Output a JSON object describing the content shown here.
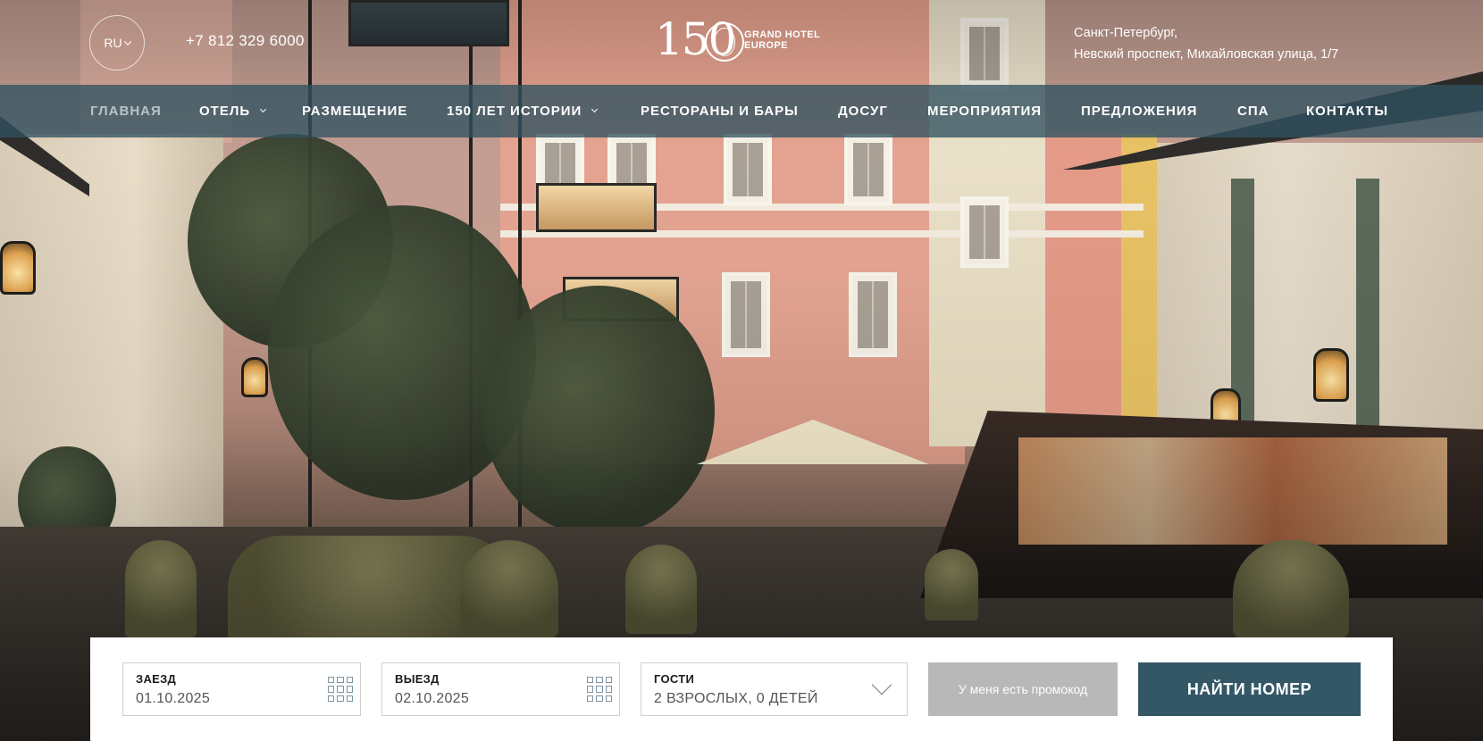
{
  "header": {
    "language": "RU",
    "phone": "+7 812 329 6000",
    "logo": {
      "number": "150",
      "line1": "GRAND HOTEL",
      "line2": "EUROPE"
    },
    "address": {
      "line1": "Санкт-Петербург,",
      "line2": "Невский проспект, Михайловская улица, 1/7"
    }
  },
  "nav": {
    "items": [
      {
        "label": "ГЛАВНАЯ",
        "active": true
      },
      {
        "label": "ОТЕЛЬ",
        "dropdown": true
      },
      {
        "label": "РАЗМЕЩЕНИЕ"
      },
      {
        "label": "150 ЛЕТ ИСТОРИИ",
        "dropdown": true
      },
      {
        "label": "РЕСТОРАНЫ И БАРЫ"
      },
      {
        "label": "ДОСУГ"
      },
      {
        "label": "МЕРОПРИЯТИЯ"
      },
      {
        "label": "ПРЕДЛОЖЕНИЯ"
      },
      {
        "label": "СПА"
      },
      {
        "label": "КОНТАКТЫ"
      }
    ]
  },
  "booking": {
    "checkin": {
      "label": "ЗАЕЗД",
      "value": "01.10.2025"
    },
    "checkout": {
      "label": "ВЫЕЗД",
      "value": "02.10.2025"
    },
    "guests": {
      "label": "ГОСТИ",
      "value": "2 ВЗРОСЛЫХ, 0 ДЕТЕЙ"
    },
    "promo_label": "У меня есть промокод",
    "search_label": "НАЙТИ НОМЕР"
  },
  "colors": {
    "nav_bar": "#315260",
    "search_button": "#345766",
    "promo_button": "#b8b8b8"
  }
}
